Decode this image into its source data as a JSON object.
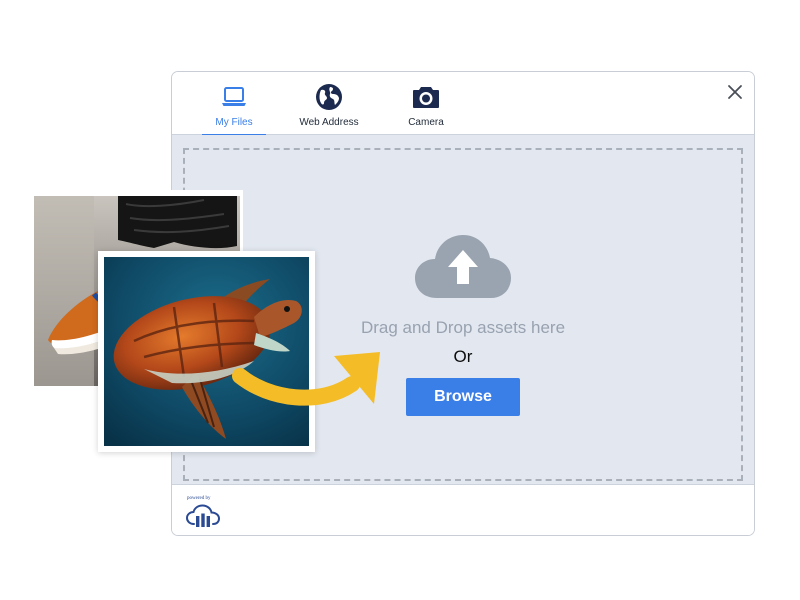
{
  "tabs": [
    {
      "label": "My Files",
      "icon": "laptop-icon",
      "active": true
    },
    {
      "label": "Web Address",
      "icon": "globe-icon",
      "active": false
    },
    {
      "label": "Camera",
      "icon": "camera-icon",
      "active": false
    }
  ],
  "close": {
    "icon": "close-icon"
  },
  "drop": {
    "icon": "cloud-upload-icon",
    "text": "Drag and Drop assets here",
    "or_text": "Or",
    "browse_label": "Browse"
  },
  "footer": {
    "powered_by": "powered by",
    "logo_icon": "cloudinary-logo"
  },
  "photos": {
    "back": "sneakers-photo",
    "front": "sea-turtle-photo"
  },
  "colors": {
    "accent": "#3a7ee8",
    "drop_bg": "#e3e8f0",
    "icon_dark": "#1b2a4e",
    "arrow": "#f4bd27"
  }
}
